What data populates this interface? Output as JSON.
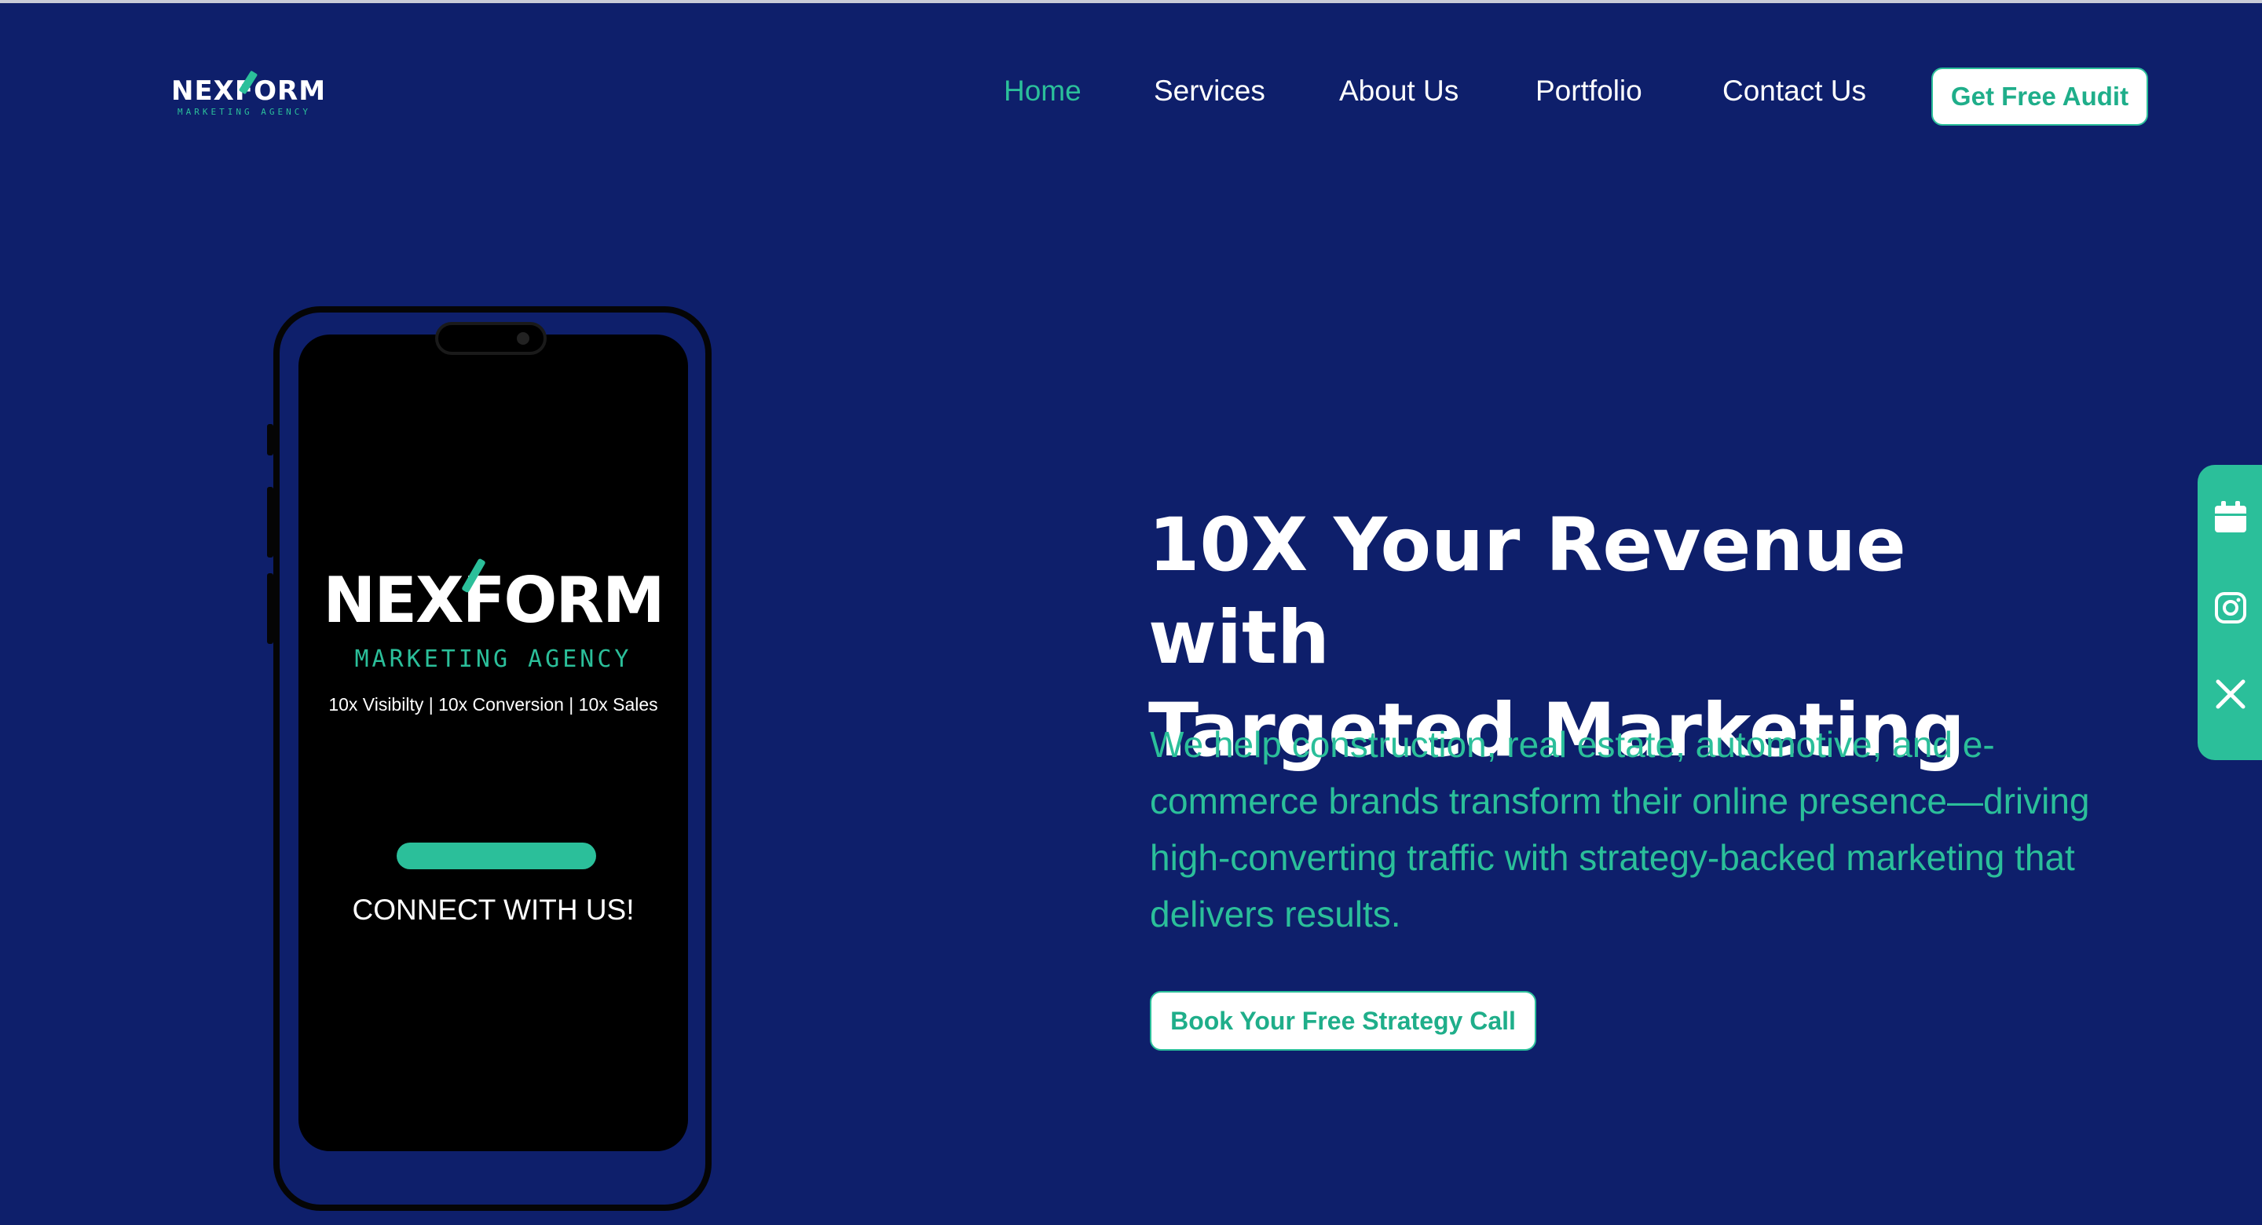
{
  "brand": {
    "logo_text": "NEXFORM",
    "logo_sub": "MARKETING AGENCY",
    "accent": "#2bbf9a",
    "background": "#0e1f6b"
  },
  "nav": {
    "items": [
      {
        "label": "Home",
        "active": true
      },
      {
        "label": "Services",
        "active": false
      },
      {
        "label": "About Us",
        "active": false
      },
      {
        "label": "Portfolio",
        "active": false
      },
      {
        "label": "Contact Us",
        "active": false
      }
    ],
    "audit_label": "Get Free Audit"
  },
  "phone": {
    "logo_text": "NEXFORM",
    "logo_sub": "MARKETING AGENCY",
    "tagline": "10x Visibilty | 10x Conversion | 10x Sales",
    "cta": "CONNECT WITH US!"
  },
  "hero": {
    "title_line1": "10X Your Revenue with",
    "title_line2": "Targeted Marketing",
    "description": "We help construction, real estate, automotive, and e-commerce brands transform their online presence—driving high-converting traffic with strategy-backed marketing that delivers results.",
    "cta_label": "Book Your Free Strategy Call"
  },
  "social": {
    "icons": [
      "calendar-icon",
      "instagram-icon",
      "x-icon"
    ]
  }
}
